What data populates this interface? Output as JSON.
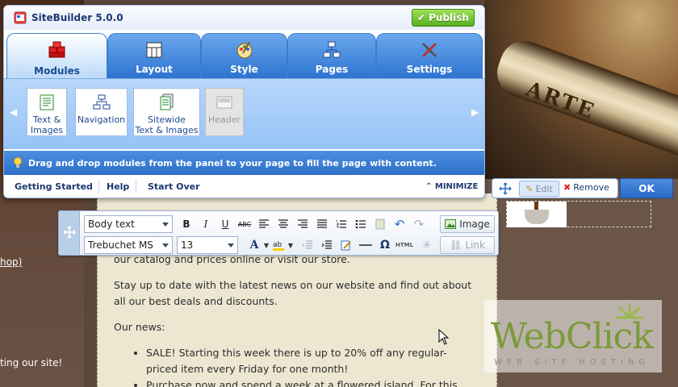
{
  "app": {
    "title": "SiteBuilder 5.0.0",
    "publish_label": "Publish"
  },
  "tabs": [
    {
      "label": "Modules",
      "icon": "modules-icon",
      "active": true
    },
    {
      "label": "Layout",
      "icon": "layout-icon"
    },
    {
      "label": "Style",
      "icon": "style-icon"
    },
    {
      "label": "Pages",
      "icon": "pages-icon"
    },
    {
      "label": "Settings",
      "icon": "settings-icon"
    }
  ],
  "modules": [
    {
      "label_1": "Text &",
      "label_2": "Images",
      "icon": "text-images-icon"
    },
    {
      "label_1": "Navigation",
      "label_2": "",
      "icon": "navigation-icon"
    },
    {
      "label_1": "Sitewide",
      "label_2": "Text & Images",
      "icon": "sitewide-icon"
    },
    {
      "label_1": "Header",
      "label_2": "",
      "icon": "header-icon",
      "disabled": true
    }
  ],
  "hint": {
    "text": "Drag and drop modules from the panel to your page to fill the page with content."
  },
  "links": {
    "getting_started": "Getting Started",
    "help": "Help",
    "start_over": "Start Over",
    "minimize": "MINIMIZE"
  },
  "edit_strip": {
    "edit_label": "Edit",
    "remove_label": "Remove",
    "ok_label": "OK"
  },
  "toolbar": {
    "style_value": "Body text",
    "font_value": "Trebuchet MS",
    "size_value": "13",
    "image_label": "Image",
    "link_label": "Link",
    "html_label": "HTML"
  },
  "content": {
    "para1": "our catalog and prices online or visit our store.",
    "para2": "Stay up to date with the latest news on our website and find out about all our best deals and discounts.",
    "para3": "Our news:",
    "bullet1": "SALE! Starting this week there is up to 20% off any regular-priced item every Friday for one month!",
    "bullet2": "Purchase now and spend a week at a flowered island. For this"
  },
  "background": {
    "left_link_fragment": "hop)",
    "left_text_fragment": "ting our site!",
    "bottle_label": "ARTE",
    "watermark_name": "WebClick",
    "watermark_sub": "WEB SITE HOSTING"
  },
  "colors": {
    "accent": "#2c6fc9",
    "publish": "#58b020",
    "tab_blue": "#2d74d0"
  }
}
